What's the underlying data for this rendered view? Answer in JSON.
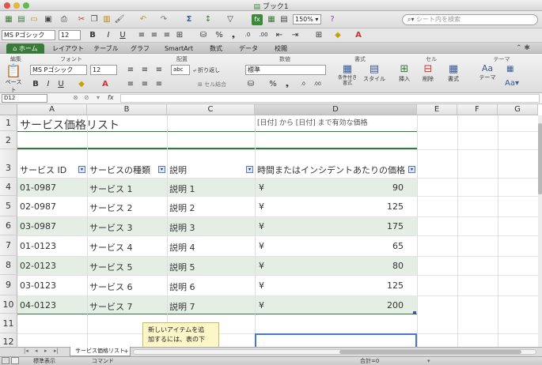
{
  "window": {
    "title": "ブック1"
  },
  "toolbar": {
    "zoom": "150%",
    "search_placeholder": "シート内を検索"
  },
  "format_bar": {
    "font": "MS Pゴシック",
    "size": "12",
    "bold": "B",
    "italic": "I",
    "underline": "U"
  },
  "ribbon_tabs": [
    "ホーム",
    "レイアウト",
    "テーブル",
    "グラフ",
    "SmartArt",
    "数式",
    "データ",
    "校閲"
  ],
  "ribbon": {
    "groups": [
      "編集",
      "フォント",
      "配置",
      "数値",
      "書式",
      "セル",
      "テーマ"
    ],
    "paste": "ペースト",
    "font": "MS Pゴシック",
    "size": "12",
    "wrap": "折り返し",
    "merge": "セル結合",
    "number_format": "標準",
    "cond_format": "条件付き\n書式",
    "style": "スタイル",
    "insert": "挿入",
    "delete": "削除",
    "format": "書式",
    "theme": "テーマ",
    "abc": "abc"
  },
  "formula_bar": {
    "name_box": "D12",
    "fx": "fx",
    "formula": ""
  },
  "columns": [
    "A",
    "B",
    "C",
    "D",
    "E",
    "F",
    "G"
  ],
  "rows": [
    "1",
    "2",
    "3",
    "4",
    "5",
    "6",
    "7",
    "8",
    "9",
    "10",
    "11",
    "12"
  ],
  "sheet": {
    "title": "サービス価格リスト",
    "date_note": "[日付] から [日付] まで有効な価格",
    "headers": [
      "サービス ID",
      "サービスの種類",
      "説明",
      "時間またはインシデントあたりの価格"
    ],
    "data": [
      [
        "01-0987",
        "サービス 1",
        "説明 1",
        "¥",
        "90"
      ],
      [
        "02-0987",
        "サービス 2",
        "説明 2",
        "¥",
        "125"
      ],
      [
        "03-0987",
        "サービス 3",
        "説明 3",
        "¥",
        "175"
      ],
      [
        "01-0123",
        "サービス 4",
        "説明 4",
        "¥",
        "65"
      ],
      [
        "02-0123",
        "サービス 5",
        "説明 5",
        "¥",
        "80"
      ],
      [
        "03-0123",
        "サービス 6",
        "説明 6",
        "¥",
        "125"
      ],
      [
        "04-0123",
        "サービス 7",
        "説明 7",
        "¥",
        "200"
      ]
    ]
  },
  "tooltip": {
    "line1": "新しいアイテムを追",
    "line2": "加するには、表の下"
  },
  "sheet_tab": "サービス価格リスト",
  "add_sheet": "+",
  "status": {
    "view": "標準表示",
    "mode": "コマンド",
    "sum": "合計=0"
  },
  "colors": {
    "accent": "#3a7a3a",
    "band": "#e4eee4",
    "border": "#2e7a3a"
  }
}
